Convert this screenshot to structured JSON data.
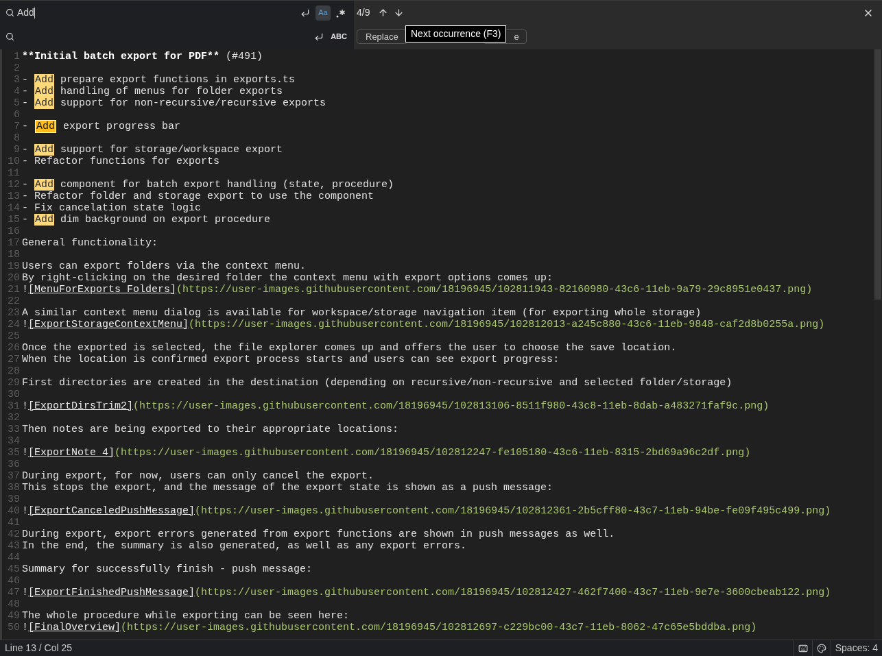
{
  "find_bar": {
    "find_field": {
      "value": "Add",
      "toggles": [
        {
          "kind": "newline",
          "selected": false
        },
        {
          "kind": "text",
          "label": "Aa",
          "selected": true
        },
        {
          "kind": "regex",
          "selected": false
        }
      ]
    },
    "replace_field": {
      "toggles": [
        {
          "kind": "newline",
          "selected": false
        },
        {
          "kind": "text",
          "label": "ABC",
          "selected": false
        }
      ]
    },
    "match_count": "4/9",
    "buttons": [
      {
        "label": "Replace"
      },
      {
        "label": "e"
      }
    ],
    "tooltip": "Next occurrence (F3)"
  },
  "editor": {
    "lines": [
      {
        "number": "1",
        "segments": [
          {
            "kind": "bold",
            "text": "**Initial batch export for PDF**"
          },
          {
            "kind": "text",
            "text": " (#491)"
          }
        ]
      },
      {
        "number": "2"
      },
      {
        "number": "3",
        "segments": [
          {
            "kind": "text",
            "text": "- "
          },
          {
            "kind": "match",
            "text": "Add",
            "selected": false
          },
          {
            "kind": "text",
            "text": " prepare export functions in exports.ts"
          }
        ]
      },
      {
        "number": "4",
        "segments": [
          {
            "kind": "text",
            "text": "- "
          },
          {
            "kind": "match",
            "text": "Add",
            "selected": false
          },
          {
            "kind": "text",
            "text": " handling of menus for folder exports"
          }
        ]
      },
      {
        "number": "5",
        "segments": [
          {
            "kind": "text",
            "text": "- "
          },
          {
            "kind": "match",
            "text": "Add",
            "selected": false
          },
          {
            "kind": "text",
            "text": " support for non-recursive/recursive exports"
          }
        ]
      },
      {
        "number": "6"
      },
      {
        "number": "7",
        "segments": [
          {
            "kind": "text",
            "text": "- "
          },
          {
            "kind": "match",
            "text": "Add",
            "selected": true
          },
          {
            "kind": "text",
            "text": " export progress bar"
          }
        ]
      },
      {
        "number": "8"
      },
      {
        "number": "9",
        "segments": [
          {
            "kind": "text",
            "text": "- "
          },
          {
            "kind": "match",
            "text": "Add",
            "selected": false
          },
          {
            "kind": "text",
            "text": " support for storage/workspace export"
          }
        ]
      },
      {
        "number": "10",
        "segments": [
          {
            "kind": "text",
            "text": "- Refactor functions for exports"
          }
        ]
      },
      {
        "number": "11"
      },
      {
        "number": "12",
        "segments": [
          {
            "kind": "text",
            "text": "- "
          },
          {
            "kind": "match",
            "text": "Add",
            "selected": false
          },
          {
            "kind": "text",
            "text": " component for batch export handling (state, procedure)"
          }
        ]
      },
      {
        "number": "13",
        "segments": [
          {
            "kind": "text",
            "text": "- Refactor folder and storage export to use the component"
          }
        ]
      },
      {
        "number": "14",
        "segments": [
          {
            "kind": "text",
            "text": "- Fix cancelation state logic"
          }
        ]
      },
      {
        "number": "15",
        "segments": [
          {
            "kind": "text",
            "text": "- "
          },
          {
            "kind": "match",
            "text": "Add",
            "selected": false
          },
          {
            "kind": "text",
            "text": " dim background on export procedure"
          }
        ]
      },
      {
        "number": "16"
      },
      {
        "number": "17",
        "segments": [
          {
            "kind": "text",
            "text": "General functionality:"
          }
        ]
      },
      {
        "number": "18"
      },
      {
        "number": "19",
        "segments": [
          {
            "kind": "text",
            "text": "Users can export folders via the context menu."
          }
        ]
      },
      {
        "number": "20",
        "segments": [
          {
            "kind": "text",
            "text": "By right-clicking on the desired folder the context menu with export options comes up:"
          }
        ]
      },
      {
        "number": "21",
        "segments": [
          {
            "kind": "text",
            "text": "!"
          },
          {
            "kind": "link",
            "text": "[MenuForExports Folders]"
          },
          {
            "kind": "url",
            "text": "(https://user-images.githubusercontent.com/18196945/102811943-82160980-43c6-11eb-9a79-29c8951e0437.png)"
          }
        ]
      },
      {
        "number": "22"
      },
      {
        "number": "23",
        "segments": [
          {
            "kind": "text",
            "text": "A similar context menu dialog is available for workspace/storage navigation item (for exporting whole storage)"
          }
        ]
      },
      {
        "number": "24",
        "segments": [
          {
            "kind": "text",
            "text": "!"
          },
          {
            "kind": "link",
            "text": "[ExportStorageContextMenu]"
          },
          {
            "kind": "url",
            "text": "(https://user-images.githubusercontent.com/18196945/102812013-a245c880-43c6-11eb-9848-caf2d8b0255a.png)"
          }
        ]
      },
      {
        "number": "25"
      },
      {
        "number": "26",
        "segments": [
          {
            "kind": "text",
            "text": "Once the exported is selected, the file explorer comes up and offers the user to choose the save location."
          }
        ]
      },
      {
        "number": "27",
        "segments": [
          {
            "kind": "text",
            "text": "When the location is confirmed export process starts and users can see export progress:"
          }
        ]
      },
      {
        "number": "28"
      },
      {
        "number": "29",
        "segments": [
          {
            "kind": "text",
            "text": "First directories are created in the destination (depending on recursive/non-recursive and selected folder/storage)"
          }
        ]
      },
      {
        "number": "30"
      },
      {
        "number": "31",
        "segments": [
          {
            "kind": "text",
            "text": "!"
          },
          {
            "kind": "link",
            "text": "[ExportDirsTrim2]"
          },
          {
            "kind": "url",
            "text": "(https://user-images.githubusercontent.com/18196945/102813106-8511f980-43c8-11eb-8dab-a483271faf9c.png)"
          }
        ]
      },
      {
        "number": "32"
      },
      {
        "number": "33",
        "segments": [
          {
            "kind": "text",
            "text": "Then notes are being exported to their appropriate locations:"
          }
        ]
      },
      {
        "number": "34"
      },
      {
        "number": "35",
        "segments": [
          {
            "kind": "text",
            "text": "!"
          },
          {
            "kind": "link",
            "text": "[ExportNote 4]"
          },
          {
            "kind": "url",
            "text": "(https://user-images.githubusercontent.com/18196945/102812247-fe105180-43c6-11eb-8315-2bd69a96c2df.png)"
          }
        ]
      },
      {
        "number": "36"
      },
      {
        "number": "37",
        "segments": [
          {
            "kind": "text",
            "text": "During export, for now, users can only cancel the export."
          }
        ]
      },
      {
        "number": "38",
        "segments": [
          {
            "kind": "text",
            "text": "This stops the export, and the message of the export state is shown as a push message:"
          }
        ]
      },
      {
        "number": "39"
      },
      {
        "number": "40",
        "segments": [
          {
            "kind": "text",
            "text": "!"
          },
          {
            "kind": "link",
            "text": "[ExportCanceledPushMessage]"
          },
          {
            "kind": "url",
            "text": "(https://user-images.githubusercontent.com/18196945/102812361-2b5cff80-43c7-11eb-94be-fe09f495c499.png)"
          }
        ]
      },
      {
        "number": "41"
      },
      {
        "number": "42",
        "segments": [
          {
            "kind": "text",
            "text": "During export, export errors generated from export functions are shown in push messages as well."
          }
        ]
      },
      {
        "number": "43",
        "segments": [
          {
            "kind": "text",
            "text": "In the end, the summary is also generated, as well as any export errors."
          }
        ]
      },
      {
        "number": "44"
      },
      {
        "number": "45",
        "segments": [
          {
            "kind": "text",
            "text": "Summary for successfully finish - push message:"
          }
        ]
      },
      {
        "number": "46"
      },
      {
        "number": "47",
        "segments": [
          {
            "kind": "text",
            "text": "!"
          },
          {
            "kind": "link",
            "text": "[ExportFinishedPushMessage]"
          },
          {
            "kind": "url",
            "text": "(https://user-images.githubusercontent.com/18196945/102812427-462f7400-43c7-11eb-9e7e-3600cbeab122.png)"
          }
        ]
      },
      {
        "number": "48"
      },
      {
        "number": "49",
        "segments": [
          {
            "kind": "text",
            "text": "The whole procedure while exporting can be seen here:"
          }
        ]
      },
      {
        "number": "50",
        "segments": [
          {
            "kind": "text",
            "text": "!"
          },
          {
            "kind": "link",
            "text": "[FinalOverview]"
          },
          {
            "kind": "url",
            "text": "(https://user-images.githubusercontent.com/18196945/102812697-c229bc00-43c7-11eb-8062-47c65e5bddba.png)"
          }
        ]
      }
    ]
  },
  "status_bar": {
    "position": "Line 13 / Col 25",
    "indentation": "Spaces: 4"
  }
}
